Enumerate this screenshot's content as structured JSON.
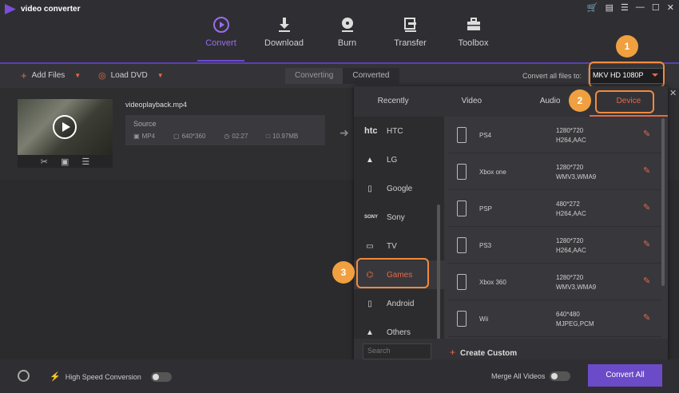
{
  "app": {
    "title": "video converter",
    "window_controls": [
      "cart-icon",
      "gift-icon",
      "menu-icon",
      "minimize-icon",
      "maximize-icon",
      "close-icon"
    ]
  },
  "nav": [
    {
      "label": "Convert",
      "icon": "play-circle-icon",
      "active": true
    },
    {
      "label": "Download",
      "icon": "download-icon"
    },
    {
      "label": "Burn",
      "icon": "disc-icon"
    },
    {
      "label": "Transfer",
      "icon": "transfer-icon"
    },
    {
      "label": "Toolbox",
      "icon": "toolbox-icon"
    }
  ],
  "toolbar": {
    "add_files": "Add Files",
    "load_dvd": "Load DVD",
    "tab_converting": "Converting",
    "tab_converted": "Converted",
    "convert_all_label": "Convert all files to:",
    "format": "MKV HD 1080P"
  },
  "file": {
    "name": "videoplayback.mp4",
    "source_label": "Source",
    "format": "MP4",
    "resolution": "640*360",
    "duration": "02:27",
    "size": "10.97MB"
  },
  "popup": {
    "tabs": [
      "Recently",
      "Video",
      "Audio",
      "Device"
    ],
    "categories": [
      {
        "label": "HTC",
        "icon": "htc-logo"
      },
      {
        "label": "LG",
        "icon": "android-icon"
      },
      {
        "label": "Google",
        "icon": "phone-icon"
      },
      {
        "label": "Sony",
        "icon": "sony-logo"
      },
      {
        "label": "TV",
        "icon": "tv-icon"
      },
      {
        "label": "Games",
        "icon": "gamepad-icon",
        "active": true
      },
      {
        "label": "Android",
        "icon": "phone-icon"
      },
      {
        "label": "Others",
        "icon": "android-icon"
      }
    ],
    "devices": [
      {
        "name": "PS4",
        "res": "1280*720",
        "codec": "H264,AAC"
      },
      {
        "name": "Xbox one",
        "res": "1280*720",
        "codec": "WMV3,WMA9"
      },
      {
        "name": "PSP",
        "res": "480*272",
        "codec": "H264,AAC"
      },
      {
        "name": "PS3",
        "res": "1280*720",
        "codec": "H264,AAC"
      },
      {
        "name": "Xbox 360",
        "res": "1280*720",
        "codec": "WMV3,WMA9"
      },
      {
        "name": "Wii",
        "res": "640*480",
        "codec": "MJPEG,PCM"
      }
    ],
    "search_placeholder": "Search",
    "create_custom": "Create Custom"
  },
  "badges": [
    "1",
    "2",
    "3"
  ],
  "bottom": {
    "high_speed": "High Speed Conversion",
    "merge": "Merge All Videos",
    "convert_all": "Convert All"
  },
  "colors": {
    "accent": "#e36a4a",
    "purple": "#6c4bc8",
    "highlight": "#f28a3e"
  }
}
